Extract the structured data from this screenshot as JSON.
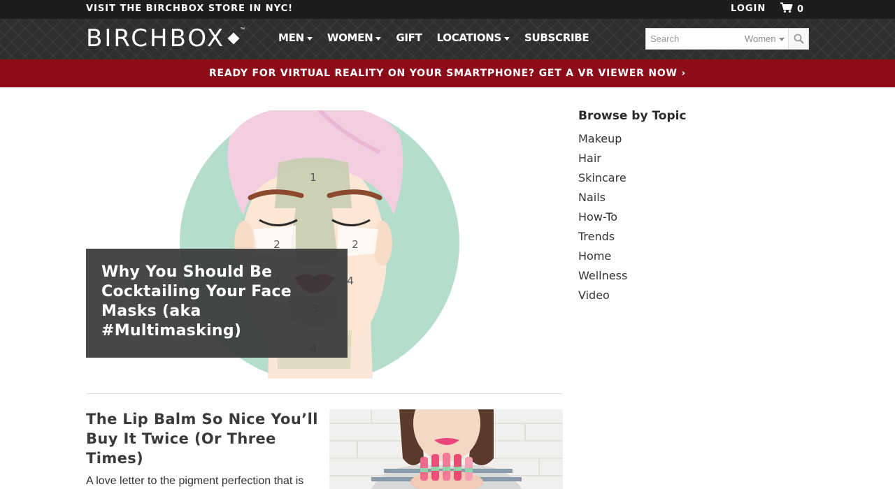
{
  "utility_bar": {
    "promo_text": "VISIT THE BIRCHBOX STORE IN NYC!",
    "login_label": "LOGIN",
    "cart_count": "0"
  },
  "header": {
    "logo_text": "BIRCHBOX",
    "logo_tm": "™",
    "nav": [
      {
        "label": "MEN",
        "has_dropdown": true
      },
      {
        "label": "WOMEN",
        "has_dropdown": true
      },
      {
        "label": "GIFT",
        "has_dropdown": false
      },
      {
        "label": "LOCATIONS",
        "has_dropdown": true
      },
      {
        "label": "SUBSCRIBE",
        "has_dropdown": false
      }
    ],
    "search": {
      "placeholder": "Search",
      "value": "",
      "category": "Women"
    }
  },
  "promo_bar": {
    "text": "READY FOR VIRTUAL REALITY ON YOUR SMARTPHONE? GET A VR VIEWER NOW ›"
  },
  "hero": {
    "title": "Why You Should Be Cocktailing Your Face Masks (aka #Multimasking)",
    "zone_labels": [
      "1",
      "2",
      "2",
      "4",
      "4",
      "3",
      "4"
    ]
  },
  "article": {
    "title": "The Lip Balm So Nice You’ll Buy It Twice (Or Three Times)",
    "excerpt": "A love letter to the pigment perfection that is"
  },
  "sidebar": {
    "heading": "Browse by Topic",
    "topics": [
      "Makeup",
      "Hair",
      "Skincare",
      "Nails",
      "How-To",
      "Trends",
      "Home",
      "Wellness",
      "Video"
    ]
  },
  "colors": {
    "utility_bg": "#1d1d1d",
    "nav_bg": "#2e2e2e",
    "promo_bg": "#8c0c1a",
    "hero_circle": "#b3dfca",
    "towel_pink": "#f2cde0"
  }
}
